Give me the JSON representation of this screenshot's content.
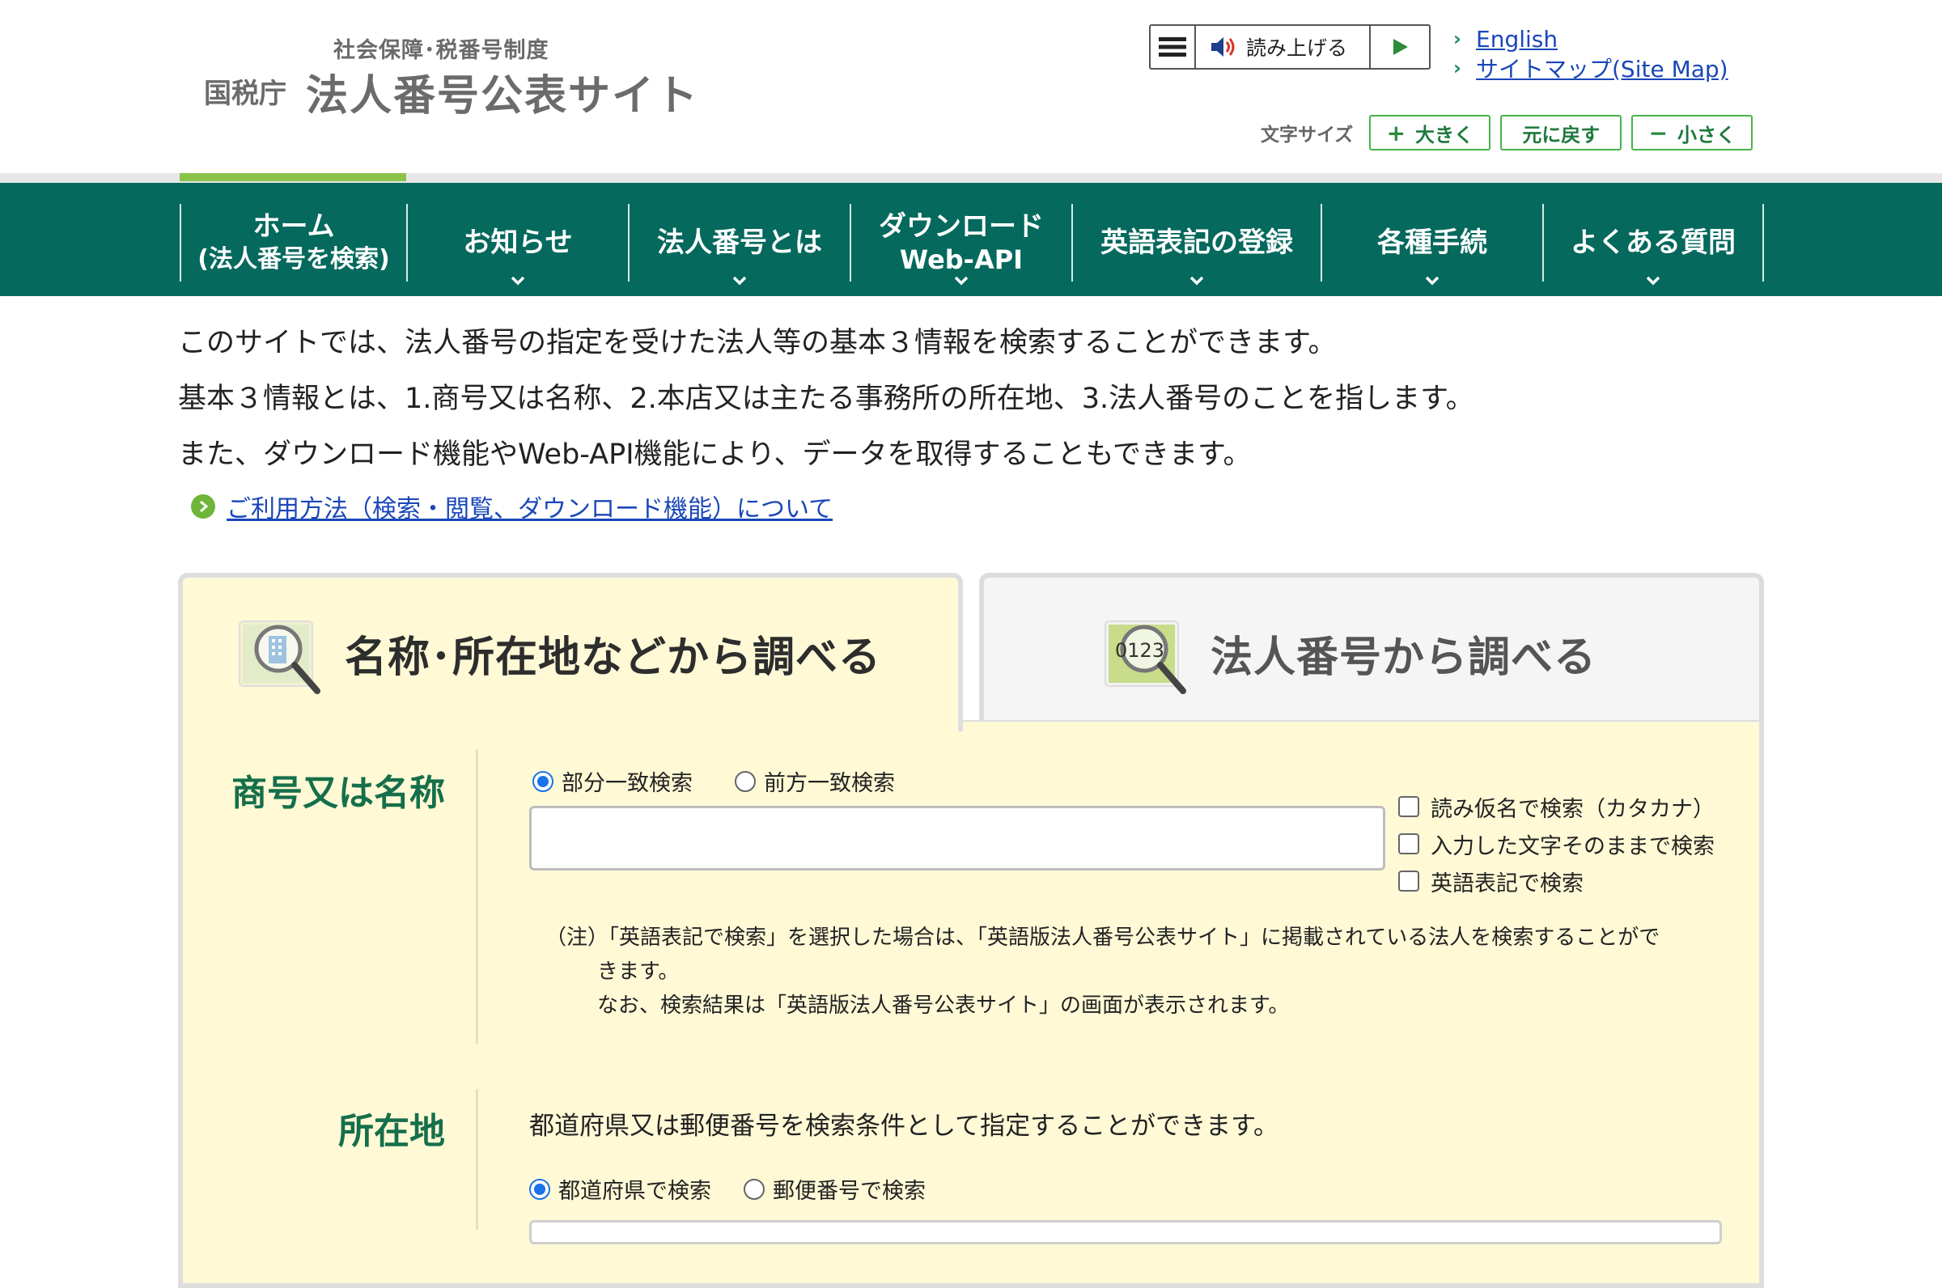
{
  "header": {
    "logo_sub": "社会保障･税番号制度",
    "logo_agency": "国税庁",
    "logo_site": "法人番号公表サイト",
    "speech_label": "読み上げる",
    "links": [
      {
        "label": "English"
      },
      {
        "label": "サイトマップ(Site Map)"
      }
    ],
    "font_size": {
      "label": "文字サイズ",
      "larger": "大きく",
      "reset": "元に戻す",
      "smaller": "小さく"
    }
  },
  "nav": {
    "items": [
      {
        "line1": "ホーム",
        "line2": "(法人番号を検索)",
        "has_caret": false
      },
      {
        "line1": "お知らせ",
        "line2": "",
        "has_caret": true
      },
      {
        "line1": "法人番号とは",
        "line2": "",
        "has_caret": true
      },
      {
        "line1": "ダウンロード",
        "line2": "Web-API",
        "has_caret": true
      },
      {
        "line1": "英語表記の登録",
        "line2": "",
        "has_caret": true
      },
      {
        "line1": "各種手続",
        "line2": "",
        "has_caret": true
      },
      {
        "line1": "よくある質問",
        "line2": "",
        "has_caret": true
      }
    ]
  },
  "intro": {
    "lines": [
      "このサイトでは、法人番号の指定を受けた法人等の基本３情報を検索することができます。",
      "基本３情報とは、1.商号又は名称、2.本店又は主たる事務所の所在地、3.法人番号のことを指します。",
      "また、ダウンロード機能やWeb-API機能により、データを取得することもできます。"
    ],
    "howto_link": "ご利用方法（検索・閲覧、ダウンロード機能）について"
  },
  "tabs": {
    "by_name": "名称･所在地などから調べる",
    "by_number": "法人番号から調べる",
    "number_icon_text": "0123"
  },
  "name_section": {
    "label": "商号又は名称",
    "match_options": [
      "部分一致検索",
      "前方一致検索"
    ],
    "selected_match": "部分一致検索",
    "input_value": "",
    "checkboxes": [
      "読み仮名で検索（カタカナ）",
      "入力した文字そのままで検索",
      "英語表記で検索"
    ],
    "note_line1": "（注）「英語表記で検索」を選択した場合は、「英語版法人番号公表サイト」に掲載されている法人を検索することがで",
    "note_line2": "きます。",
    "note_line3": "なお、検索結果は「英語版法人番号公表サイト」の画面が表示されます。"
  },
  "location_section": {
    "label": "所在地",
    "description": "都道府県又は郵便番号を検索条件として指定することができます。",
    "options": [
      "都道府県で検索",
      "郵便番号で検索"
    ],
    "selected": "都道府県で検索"
  },
  "colors": {
    "nav_bg": "#05695d",
    "active_bar": "#8bc34a",
    "panel_bg": "#fff9d6",
    "label_green": "#156f4a",
    "link_blue": "#1a47b8",
    "radio_blue": "#1a73e8"
  }
}
